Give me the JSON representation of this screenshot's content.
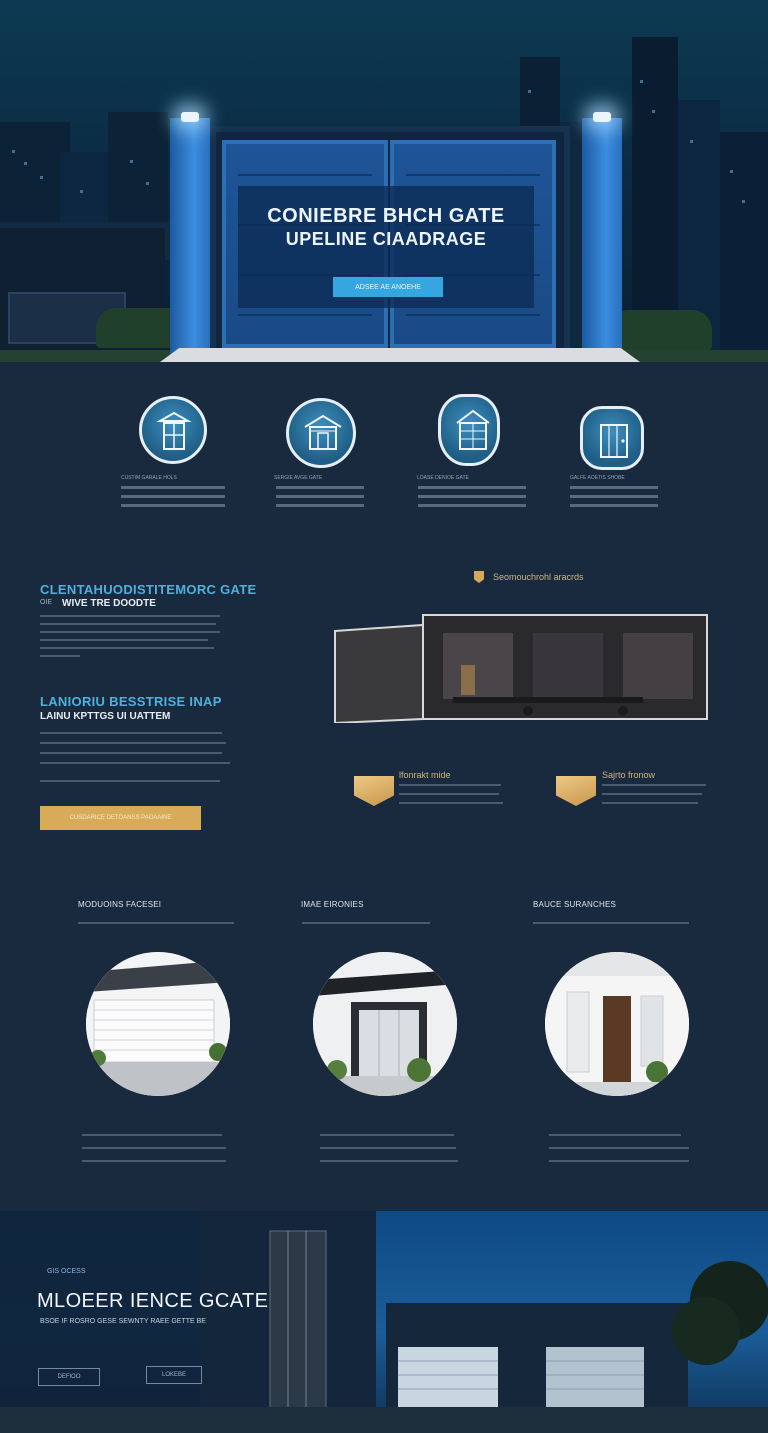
{
  "hero": {
    "title_line1": "CONIEBRE BHCH GATE",
    "title_line2": "UPELINE CIAADRAGE",
    "cta_label": "ADSEE AE ANOEHE"
  },
  "features": [
    {
      "icon": "classic-door-icon",
      "label": "CUSTIM GARALE HOLS"
    },
    {
      "icon": "porch-house-icon",
      "label": "SERGIE AVGE GATE"
    },
    {
      "icon": "gable-house-icon",
      "label": "LOASE DENIOE GATE"
    },
    {
      "icon": "modern-door-icon",
      "label": "GALFE AOETIS SHOBE"
    }
  ],
  "about": {
    "heading1": "CLENTAHUODISTITEMORC GATE",
    "subheading1_prefix": "OIE",
    "subheading1": "WIVE TRE DOODTE",
    "heading2": "LANIORIU BESSTRISE INAP",
    "subheading2": "LAINU KPTTGS UI UATTEM",
    "cta_label": "CUSDARICE DETOANSS PAOAAINE",
    "showcase_label": "Seomouchrohl aracrds",
    "badges": [
      {
        "label": "lfonrakt mide",
        "icon": "gold-shield-icon"
      },
      {
        "label": "Sajrto fronow",
        "icon": "gold-shield-icon"
      }
    ]
  },
  "services": [
    {
      "title": "MODUOINS FACESEI",
      "image": "white-garage-photo"
    },
    {
      "title": "IMAE EIRONIES",
      "image": "modern-entry-photo"
    },
    {
      "title": "BAUCE SURANCHES",
      "image": "wood-door-photo"
    }
  ],
  "footer": {
    "kicker": "GIS OCESS",
    "title": "MLOEER IENCE GCATE",
    "description": "BSOE IF ROSRO GESE SEWNTY RAEE GETTE BE",
    "button1": "DEFIOO",
    "button2": "LOKEBE"
  }
}
